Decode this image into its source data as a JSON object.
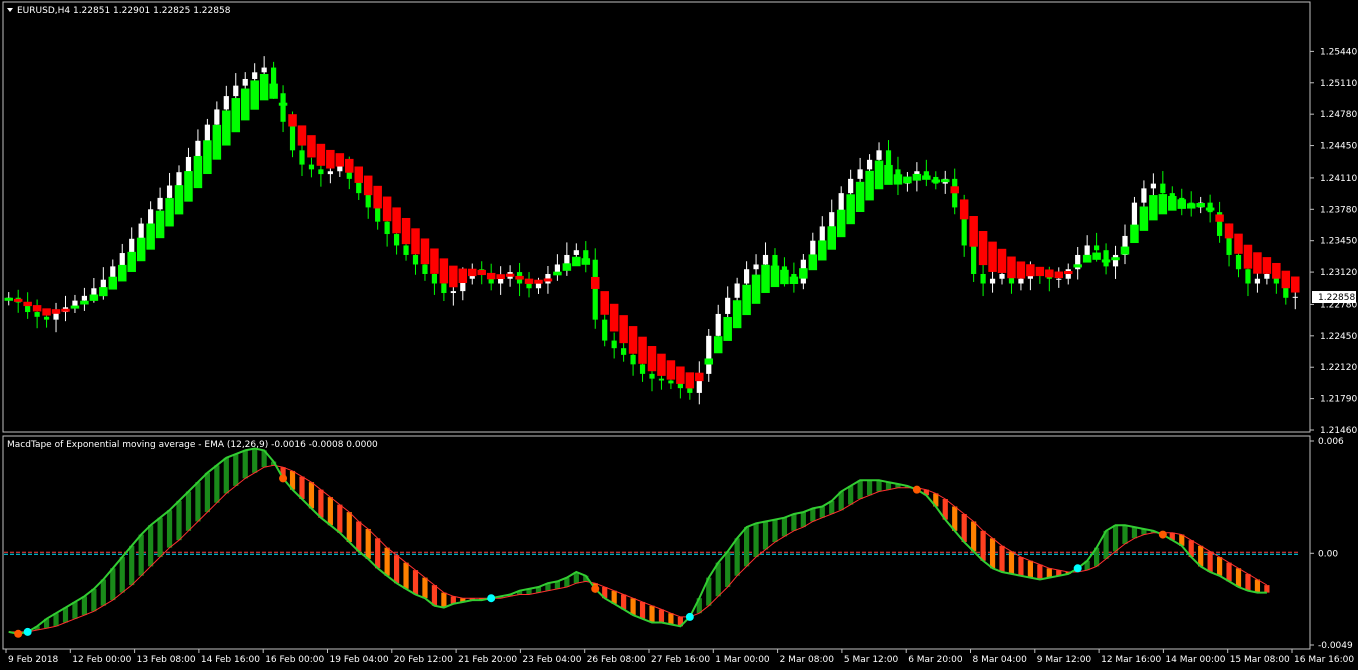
{
  "main_panel": {
    "title": "EURUSD,H4  1.22851 1.22901 1.22825 1.22858",
    "current_price": "1.22858",
    "price_ticks": [
      "1.25440",
      "1.25110",
      "1.24780",
      "1.24450",
      "1.24110",
      "1.23780",
      "1.23450",
      "1.23120",
      "1.22780",
      "1.22450",
      "1.22120",
      "1.21790",
      "1.21460"
    ]
  },
  "sub_panel": {
    "title": "MacdTape of Exponential moving average - EMA (12,26,9) -0.0016 -0.0008 0.0000",
    "ticks": [
      "0.006",
      "0.00",
      "-0.0049"
    ]
  },
  "time_axis": [
    "9 Feb 2018",
    "12 Feb 00:00",
    "13 Feb 08:00",
    "14 Feb 16:00",
    "16 Feb 00:00",
    "19 Feb 04:00",
    "20 Feb 12:00",
    "21 Feb 20:00",
    "23 Feb 04:00",
    "26 Feb 08:00",
    "27 Feb 16:00",
    "1 Mar 00:00",
    "2 Mar 08:00",
    "5 Mar 12:00",
    "6 Mar 20:00",
    "8 Mar 04:00",
    "9 Mar 12:00",
    "12 Mar 16:00",
    "14 Mar 00:00",
    "15 Mar 08:00",
    "16 Mar 16:00"
  ],
  "colors": {
    "background": "#000000",
    "frame": "#c0c0c0",
    "bull_tape": "#00ff00",
    "bear_tape": "#ff0000",
    "candle_up": "#ffffff",
    "candle_down": "#00ff00",
    "macd_line": "#32cd32",
    "signal_line": "#ff3030",
    "hist_up": "#1a8a1a",
    "hist_down_a": "#ff4020",
    "hist_down_b": "#ff8000",
    "zero_line_red": "#ff4040",
    "zero_line_cyan": "#00e5ff",
    "cross_up_dot": "#00ffff",
    "cross_down_dot": "#ff5a00"
  },
  "chart_data": [
    {
      "type": "candlestick",
      "title": "EURUSD,H4",
      "ylim": [
        1.2146,
        1.2577
      ],
      "close": [
        1.2285,
        1.228,
        1.227,
        1.2265,
        1.2262,
        1.227,
        1.2275,
        1.2282,
        1.2287,
        1.2295,
        1.2304,
        1.2318,
        1.2332,
        1.2347,
        1.2363,
        1.2378,
        1.239,
        1.2403,
        1.2417,
        1.2433,
        1.245,
        1.2467,
        1.2483,
        1.2497,
        1.2508,
        1.2515,
        1.2522,
        1.2527,
        1.25,
        1.247,
        1.244,
        1.2425,
        1.242,
        1.2415,
        1.2418,
        1.2425,
        1.241,
        1.2395,
        1.238,
        1.2365,
        1.2352,
        1.234,
        1.233,
        1.232,
        1.231,
        1.23,
        1.229,
        1.2292,
        1.2305,
        1.2315,
        1.231,
        1.23,
        1.2305,
        1.2312,
        1.23,
        1.2295,
        1.23,
        1.231,
        1.232,
        1.233,
        1.2335,
        1.2325,
        1.2262,
        1.224,
        1.2232,
        1.2225,
        1.2215,
        1.2205,
        1.22,
        1.2198,
        1.2195,
        1.219,
        1.2185,
        1.2205,
        1.2245,
        1.2268,
        1.2285,
        1.23,
        1.2315,
        1.232,
        1.233,
        1.2318,
        1.231,
        1.23,
        1.2325,
        1.2345,
        1.236,
        1.2375,
        1.2395,
        1.241,
        1.242,
        1.243,
        1.244,
        1.242,
        1.2405,
        1.241,
        1.2418,
        1.2412,
        1.2405,
        1.241,
        1.238,
        1.234,
        1.231,
        1.23,
        1.2305,
        1.231,
        1.23,
        1.2305,
        1.231,
        1.2308,
        1.2305,
        1.2305,
        1.2315,
        1.233,
        1.234,
        1.2335,
        1.2318,
        1.233,
        1.235,
        1.2385,
        1.24,
        1.2405,
        1.2395,
        1.239,
        1.2385,
        1.238,
        1.2385,
        1.2375,
        1.235,
        1.233,
        1.2315,
        1.23,
        1.2305,
        1.231,
        1.23,
        1.2285,
        1.2286
      ]
    },
    {
      "type": "line",
      "title": "MacdTape of Exponential moving average - EMA (12,26,9)",
      "ylim": [
        -0.0049,
        0.006
      ],
      "series": [
        {
          "values": [
            -0.0042,
            -0.0043,
            -0.0042,
            -0.0039,
            -0.0035,
            -0.0032,
            -0.0029,
            -0.0026,
            -0.0023,
            -0.0019,
            -0.0014,
            -0.0008,
            -0.0002,
            0.0004,
            0.001,
            0.0015,
            0.0019,
            0.0023,
            0.0028,
            0.0033,
            0.0038,
            0.0043,
            0.0047,
            0.0051,
            0.0053,
            0.0055,
            0.0056,
            0.0055,
            0.0049,
            0.004,
            0.0034,
            0.0029,
            0.0024,
            0.0019,
            0.0015,
            0.0011,
            0.0006,
            0.0001,
            -0.0003,
            -0.0008,
            -0.0012,
            -0.0016,
            -0.0019,
            -0.0022,
            -0.0024,
            -0.0028,
            -0.0029,
            -0.0027,
            -0.0026,
            -0.0025,
            -0.0025,
            -0.0024,
            -0.0023,
            -0.0022,
            -0.002,
            -0.0019,
            -0.0018,
            -0.0016,
            -0.0015,
            -0.0013,
            -0.001,
            -0.0012,
            -0.0019,
            -0.0024,
            -0.0027,
            -0.003,
            -0.0033,
            -0.0035,
            -0.0037,
            -0.0037,
            -0.0038,
            -0.0039,
            -0.0034,
            -0.0024,
            -0.0013,
            -0.0005,
            0.0001,
            0.0008,
            0.0014,
            0.0016,
            0.0017,
            0.0018,
            0.0019,
            0.0021,
            0.0022,
            0.0024,
            0.0025,
            0.0028,
            0.0033,
            0.0036,
            0.0039,
            0.0039,
            0.0039,
            0.0038,
            0.0037,
            0.0036,
            0.0034,
            0.0031,
            0.0025,
            0.0018,
            0.0012,
            0.0006,
            0.0001,
            -0.0004,
            -0.0008,
            -0.001,
            -0.0011,
            -0.0012,
            -0.0013,
            -0.0014,
            -0.0013,
            -0.0012,
            -0.0011,
            -0.0008,
            -0.0004,
            0.0003,
            0.0012,
            0.0015,
            0.0015,
            0.0014,
            0.0013,
            0.0012,
            0.001,
            0.0007,
            0.0004,
            -0.0002,
            -0.0007,
            -0.001,
            -0.0012,
            -0.0015,
            -0.0018,
            -0.002,
            -0.0021,
            -0.0021
          ]
        },
        {
          "values": [
            -0.0042,
            -0.0042,
            -0.0042,
            -0.0041,
            -0.004,
            -0.0039,
            -0.0037,
            -0.0035,
            -0.0033,
            -0.0031,
            -0.0028,
            -0.0025,
            -0.0021,
            -0.0017,
            -0.0012,
            -0.0007,
            -0.0002,
            0.0003,
            0.0007,
            0.0012,
            0.0017,
            0.0022,
            0.0027,
            0.0032,
            0.0036,
            0.004,
            0.0043,
            0.0046,
            0.0047,
            0.0046,
            0.0044,
            0.0041,
            0.0038,
            0.0034,
            0.003,
            0.0026,
            0.0022,
            0.0017,
            0.0013,
            0.0008,
            0.0003,
            -0.0001,
            -0.0005,
            -0.0009,
            -0.0013,
            -0.0017,
            -0.0021,
            -0.0023,
            -0.0024,
            -0.0024,
            -0.0024,
            -0.0024,
            -0.0024,
            -0.0023,
            -0.0022,
            -0.0022,
            -0.0021,
            -0.002,
            -0.0019,
            -0.0018,
            -0.0016,
            -0.0015,
            -0.0016,
            -0.0018,
            -0.002,
            -0.0022,
            -0.0024,
            -0.0026,
            -0.0028,
            -0.003,
            -0.0032,
            -0.0034,
            -0.0034,
            -0.0032,
            -0.0028,
            -0.0023,
            -0.0018,
            -0.0012,
            -0.0007,
            -0.0002,
            0.0002,
            0.0006,
            0.0009,
            0.0012,
            0.0014,
            0.0017,
            0.0019,
            0.0021,
            0.0023,
            0.0026,
            0.0029,
            0.0031,
            0.0033,
            0.0034,
            0.0035,
            0.0035,
            0.0035,
            0.0034,
            0.0032,
            0.0029,
            0.0025,
            0.0021,
            0.0017,
            0.0012,
            0.0008,
            0.0004,
            0.0001,
            -0.0002,
            -0.0004,
            -0.0006,
            -0.0008,
            -0.0009,
            -0.001,
            -0.001,
            -0.0009,
            -0.0007,
            -0.0003,
            0.0001,
            0.0005,
            0.0008,
            0.001,
            0.0011,
            0.0011,
            0.0011,
            0.001,
            0.0007,
            0.0004,
            0.0001,
            -0.0002,
            -0.0005,
            -0.0008,
            -0.0011,
            -0.0014,
            -0.0017
          ]
        }
      ],
      "zero_level": 0.0
    }
  ]
}
